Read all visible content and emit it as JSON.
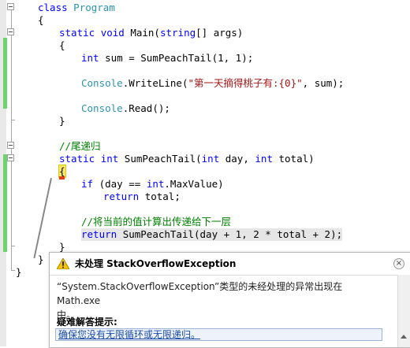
{
  "editor": {
    "lines": {
      "l1": {
        "kw": "class",
        "type": "Program"
      },
      "l2": {
        "text": "{"
      },
      "l3": {
        "kw1": "static",
        "kw2": "void",
        "rest1": "Main(",
        "kw3": "string",
        "rest2": "[] args)"
      },
      "l4": {
        "text": "{"
      },
      "l5": {
        "kw": "int",
        "rest": "sum = SumPeachTail(1, 1);"
      },
      "l6": {
        "type": "Console",
        "rest1": ".WriteLine(",
        "str": "\"第一天摘得桃子有:{0}\"",
        "rest2": ", sum);"
      },
      "l7": {
        "type": "Console",
        "rest": ".Read();"
      },
      "l8": {
        "text": "}"
      },
      "l9": {
        "comment": "//尾递归"
      },
      "l10": {
        "kw1": "static",
        "kw2": "int",
        "rest1": "SumPeachTail(",
        "kw3": "int",
        "rest2": "day, ",
        "kw4": "int",
        "rest3": "total)"
      },
      "l11": {
        "text": "{"
      },
      "l12": {
        "kw1": "if",
        "rest1": "(day == ",
        "kw2": "int",
        "rest2": ".MaxValue)"
      },
      "l13": {
        "kw": "return",
        "rest": "total;"
      },
      "l14": {
        "comment": "//将当前的值计算出传递给下一层"
      },
      "l15": {
        "kw": "return",
        "rest": "SumPeachTail(day + 1, 2 * total + 2);"
      },
      "l16": {
        "text": "}"
      },
      "l17": {
        "text": "}"
      },
      "l18": {
        "text": "}"
      }
    }
  },
  "exception_popup": {
    "title": "未处理 StackOverflowException",
    "message_line1": "“System.StackOverflowException”类型的未经处理的异常出现在 Math.exe",
    "message_line2": "中。",
    "tips_title": "疑难解答提示:",
    "tip_link": "确保您没有无限循环或无限递归。",
    "close_label": "×"
  },
  "colors": {
    "keyword": "#0000ff",
    "type": "#2b91af",
    "string": "#a31515",
    "comment": "#008000",
    "change_bar": "#6dd36d",
    "brace_highlight": "#f5e76b",
    "warning_icon": "#f2c400"
  }
}
